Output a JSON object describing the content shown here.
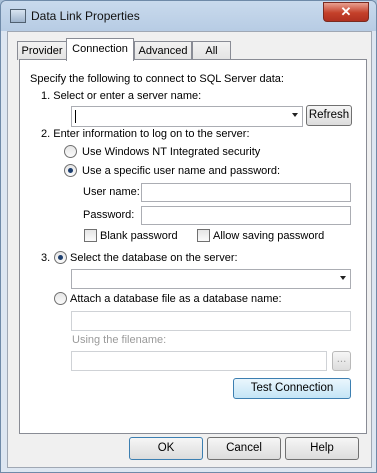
{
  "window": {
    "title": "Data Link Properties",
    "close_glyph": "✕",
    "title_icon": "data-link-icon"
  },
  "tabs": [
    {
      "label": "Provider",
      "active": false
    },
    {
      "label": "Connection",
      "active": true
    },
    {
      "label": "Advanced",
      "active": false
    },
    {
      "label": "All",
      "active": false
    }
  ],
  "connection": {
    "intro": "Specify the following to connect to SQL Server data:",
    "step1": {
      "label": "1. Select or enter a server name:",
      "server_value": "",
      "refresh_label": "Refresh"
    },
    "step2": {
      "label": "2. Enter information to log on to the server:",
      "windows_nt_label": "Use Windows NT Integrated security",
      "specific_user_label": "Use a specific user name and password:",
      "user_name_label": "User name:",
      "user_name_value": "",
      "password_label": "Password:",
      "password_value": "",
      "blank_password_label": "Blank password",
      "allow_saving_label": "Allow saving password",
      "selected": "specific_user"
    },
    "step3": {
      "label": "3.",
      "select_db_label": "Select the database on the server:",
      "database_value": "",
      "attach_label": "Attach a database file as a database name:",
      "attach_value": "",
      "filename_label": "Using the filename:",
      "filename_value": "",
      "browse_label": "...",
      "selected": "select_db"
    },
    "test_button_label": "Test Connection"
  },
  "footer": {
    "ok_label": "OK",
    "cancel_label": "Cancel",
    "help_label": "Help"
  }
}
